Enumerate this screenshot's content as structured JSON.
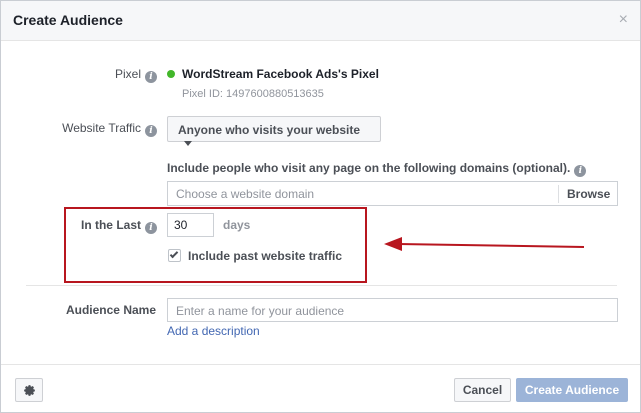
{
  "dialog": {
    "title": "Create Audience",
    "close_glyph": "×"
  },
  "pixel": {
    "label": "Pixel",
    "name": "WordStream Facebook Ads's Pixel",
    "id_text": "Pixel ID: 1497600880513635",
    "status_color": "#42b72a"
  },
  "website_traffic": {
    "label": "Website Traffic",
    "selected": "Anyone who visits your website"
  },
  "domains": {
    "include_text": "Include people who visit any page on the following domains (optional).",
    "placeholder": "Choose a website domain",
    "browse_label": "Browse"
  },
  "retention": {
    "label": "In the Last",
    "value": "30",
    "unit": "days",
    "include_past_label": "Include past website traffic",
    "include_past_checked": true
  },
  "audience_name": {
    "label": "Audience Name",
    "placeholder": "Enter a name for your audience",
    "add_description": "Add a description"
  },
  "footer": {
    "cancel_label": "Cancel",
    "create_label": "Create Audience"
  },
  "annotation": {
    "color": "#b8161f"
  }
}
